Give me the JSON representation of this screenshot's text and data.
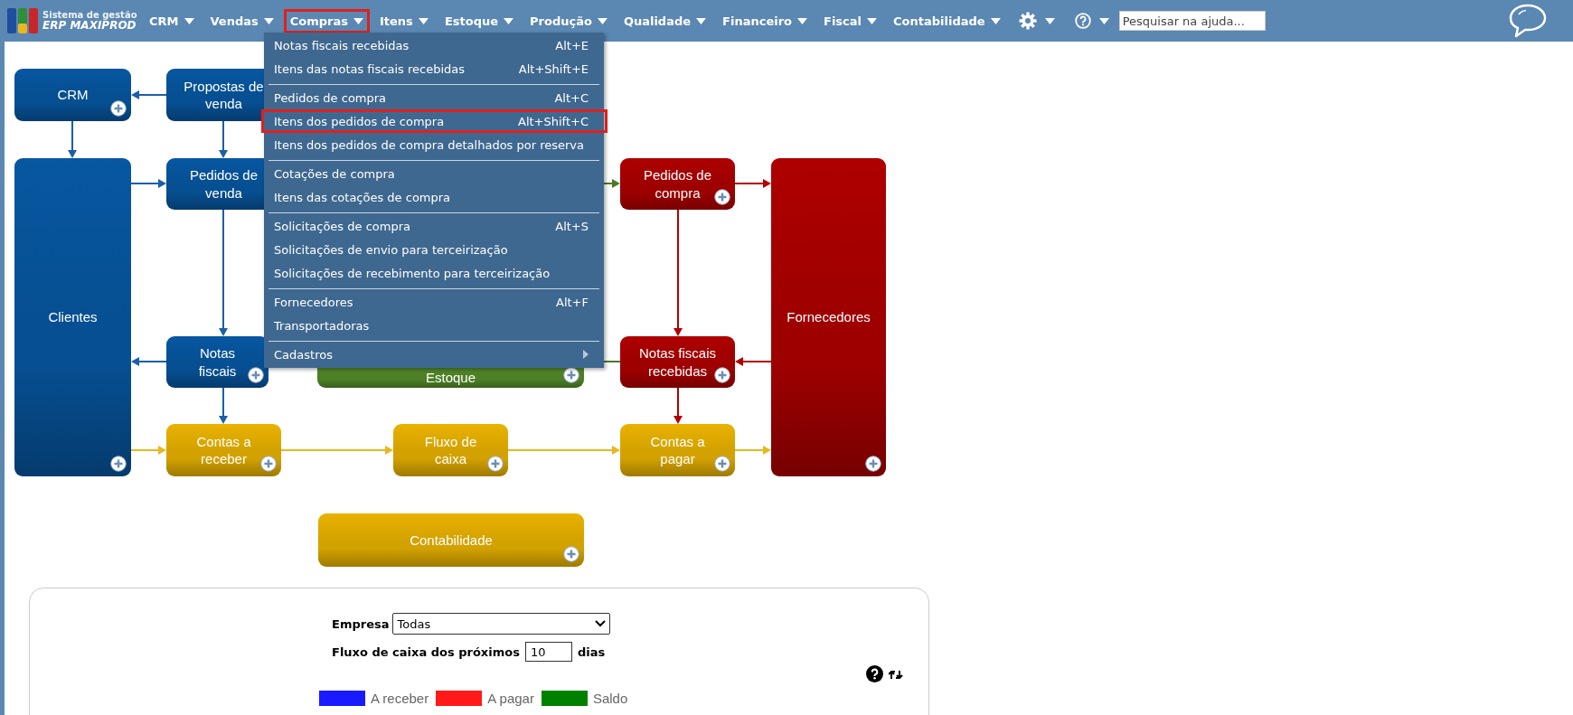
{
  "header": {
    "logo": {
      "line_1": "Sistema de gestão",
      "line_2": "ERP MAXIPROD"
    },
    "nav": [
      {
        "kind": "text",
        "label": "CRM",
        "selected": false
      },
      {
        "kind": "text",
        "label": "Vendas",
        "selected": false
      },
      {
        "kind": "text",
        "label": "Compras",
        "selected": true
      },
      {
        "kind": "text",
        "label": "Itens",
        "selected": false
      },
      {
        "kind": "text",
        "label": "Estoque",
        "selected": false
      },
      {
        "kind": "text",
        "label": "Produção",
        "selected": false
      },
      {
        "kind": "text",
        "label": "Qualidade",
        "selected": false
      },
      {
        "kind": "text",
        "label": "Financeiro",
        "selected": false
      },
      {
        "kind": "text",
        "label": "Fiscal",
        "selected": false
      },
      {
        "kind": "text",
        "label": "Contabilidade",
        "selected": false
      },
      {
        "kind": "gear",
        "selected": false
      },
      {
        "kind": "help",
        "selected": false
      }
    ],
    "search": {
      "placeholder": "Pesquisar na ajuda..."
    }
  },
  "menu": {
    "items": [
      {
        "label": "Notas fiscais recebidas",
        "shortcut": "Alt+E",
        "selected": false,
        "separator_before": false,
        "submenu": false
      },
      {
        "label": "Itens das notas fiscais recebidas",
        "shortcut": "Alt+Shift+E",
        "selected": false,
        "separator_before": false,
        "submenu": false
      },
      {
        "label": "Pedidos de compra",
        "shortcut": "Alt+C",
        "selected": false,
        "separator_before": true,
        "submenu": false
      },
      {
        "label": "Itens dos pedidos de compra",
        "shortcut": "Alt+Shift+C",
        "selected": true,
        "separator_before": false,
        "submenu": false
      },
      {
        "label": "Itens dos pedidos de compra detalhados por reserva",
        "selected": false,
        "separator_before": false,
        "submenu": false
      },
      {
        "label": "Cotações de compra",
        "selected": false,
        "separator_before": true,
        "submenu": false
      },
      {
        "label": "Itens das cotações de compra",
        "selected": false,
        "separator_before": false,
        "submenu": false
      },
      {
        "label": "Solicitações de compra",
        "shortcut": "Alt+S",
        "selected": false,
        "separator_before": true,
        "submenu": false
      },
      {
        "label": "Solicitações de envio para terceirização",
        "selected": false,
        "separator_before": false,
        "submenu": false
      },
      {
        "label": "Solicitações de recebimento para terceirização",
        "selected": false,
        "separator_before": false,
        "submenu": false
      },
      {
        "label": "Fornecedores",
        "shortcut": "Alt+F",
        "selected": false,
        "separator_before": true,
        "submenu": false
      },
      {
        "label": "Transportadoras",
        "selected": false,
        "separator_before": false,
        "submenu": false
      },
      {
        "label": "Cadastros",
        "selected": false,
        "separator_before": true,
        "submenu": true
      }
    ]
  },
  "diagram": {
    "nodes": [
      {
        "lines": [
          "CRM"
        ],
        "color": "#064f92",
        "add_button": true
      },
      {
        "lines": [
          "Propostas de",
          "venda"
        ],
        "color": "#064f92",
        "add_button": false
      },
      {
        "lines": [
          "Clientes"
        ],
        "color": "#064f92",
        "add_button": true
      },
      {
        "lines": [
          "Pedidos de",
          "venda"
        ],
        "color": "#064f92",
        "add_button": false
      },
      {
        "lines": [
          "Pedidos de",
          "compra"
        ],
        "color": "#9e0000",
        "add_button": true
      },
      {
        "lines": [
          "Fornecedores"
        ],
        "color": "#9e0000",
        "add_button": true
      },
      {
        "lines": [
          "Notas",
          "fiscais"
        ],
        "color": "#064f92",
        "add_button": true
      },
      {
        "lines": [
          "Estoque"
        ],
        "color": "#4d7f25",
        "add_button": true
      },
      {
        "lines": [
          "Notas fiscais",
          "recebidas"
        ],
        "color": "#9e0000",
        "add_button": true
      },
      {
        "lines": [
          "Contas a",
          "receber"
        ],
        "color": "#d4a200",
        "add_button": true
      },
      {
        "lines": [
          "Fluxo de",
          "caixa"
        ],
        "color": "#d4a200",
        "add_button": true
      },
      {
        "lines": [
          "Contas a",
          "pagar"
        ],
        "color": "#d4a200",
        "add_button": true
      },
      {
        "lines": [
          "Contabilidade"
        ],
        "color": "#d4a200",
        "add_button": true
      }
    ]
  },
  "panel": {
    "company": {
      "label": "Empresa",
      "value": "Todas"
    },
    "horizon": {
      "label": "Fluxo de caixa dos próximos",
      "value": "10",
      "unit": "dias"
    },
    "legend": [
      {
        "label": "A receber",
        "color": "#1a1aff"
      },
      {
        "label": "A pagar",
        "color": "#ff1a1a"
      },
      {
        "label": "Saldo",
        "color": "#008000"
      }
    ]
  }
}
